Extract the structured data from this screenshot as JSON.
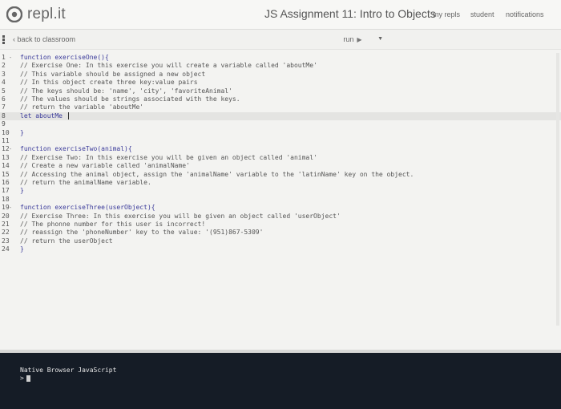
{
  "brand": {
    "name": "repl.it"
  },
  "header": {
    "title": "JS Assignment 11: Intro to Objects",
    "nav": [
      "my repls",
      "student",
      "notifications"
    ]
  },
  "subbar": {
    "back_label": "back to classroom",
    "run_label": "run"
  },
  "editor": {
    "lines": [
      {
        "n": "1",
        "fold": "true",
        "text": "function exerciseOne(){"
      },
      {
        "n": "2",
        "fold": "false",
        "text": "// Exercise One: In this exercise you will create a variable called 'aboutMe'"
      },
      {
        "n": "3",
        "fold": "false",
        "text": "// This variable should be assigned a new object"
      },
      {
        "n": "4",
        "fold": "false",
        "text": "// In this object create three key:value pairs"
      },
      {
        "n": "5",
        "fold": "false",
        "text": "// The keys should be: 'name', 'city', 'favoriteAnimal'"
      },
      {
        "n": "6",
        "fold": "false",
        "text": "// The values should be strings associated with the keys."
      },
      {
        "n": "7",
        "fold": "false",
        "text": "// return the variable 'aboutMe'"
      },
      {
        "n": "8",
        "fold": "false",
        "text": "let aboutMe "
      },
      {
        "n": "9",
        "fold": "false",
        "text": ""
      },
      {
        "n": "10",
        "fold": "false",
        "text": "}"
      },
      {
        "n": "11",
        "fold": "false",
        "text": ""
      },
      {
        "n": "12",
        "fold": "true",
        "text": "function exerciseTwo(animal){"
      },
      {
        "n": "13",
        "fold": "false",
        "text": "// Exercise Two: In this exercise you will be given an object called 'animal'"
      },
      {
        "n": "14",
        "fold": "false",
        "text": "// Create a new variable called 'animalName'"
      },
      {
        "n": "15",
        "fold": "false",
        "text": "// Accessing the animal object, assign the 'animalName' variable to the 'latinName' key on the object."
      },
      {
        "n": "16",
        "fold": "false",
        "text": "// return the animalName variable."
      },
      {
        "n": "17",
        "fold": "false",
        "text": "}"
      },
      {
        "n": "18",
        "fold": "false",
        "text": ""
      },
      {
        "n": "19",
        "fold": "true",
        "text": "function exerciseThree(userObject){"
      },
      {
        "n": "20",
        "fold": "false",
        "text": "// Exercise Three: In this exercise you will be given an object called 'userObject'"
      },
      {
        "n": "21",
        "fold": "false",
        "text": "// The phonne number for this user is incorrect!"
      },
      {
        "n": "22",
        "fold": "false",
        "text": "// reassign the 'phoneNumber' key to the value: '(951)867-5309'"
      },
      {
        "n": "23",
        "fold": "false",
        "text": "// return the userObject"
      },
      {
        "n": "24",
        "fold": "false",
        "text": "}"
      }
    ],
    "active_line": "8"
  },
  "console": {
    "header": "Native Browser JavaScript",
    "prompt": ">"
  },
  "icons": {
    "logo": "repl-logo-icon",
    "menu": "menu-icon",
    "back": "chevron-left-icon",
    "run": "play-icon",
    "dropdown": "caret-down-icon"
  },
  "colors": {
    "console_bg": "#151c26",
    "editor_bg": "#f3f3f1"
  }
}
